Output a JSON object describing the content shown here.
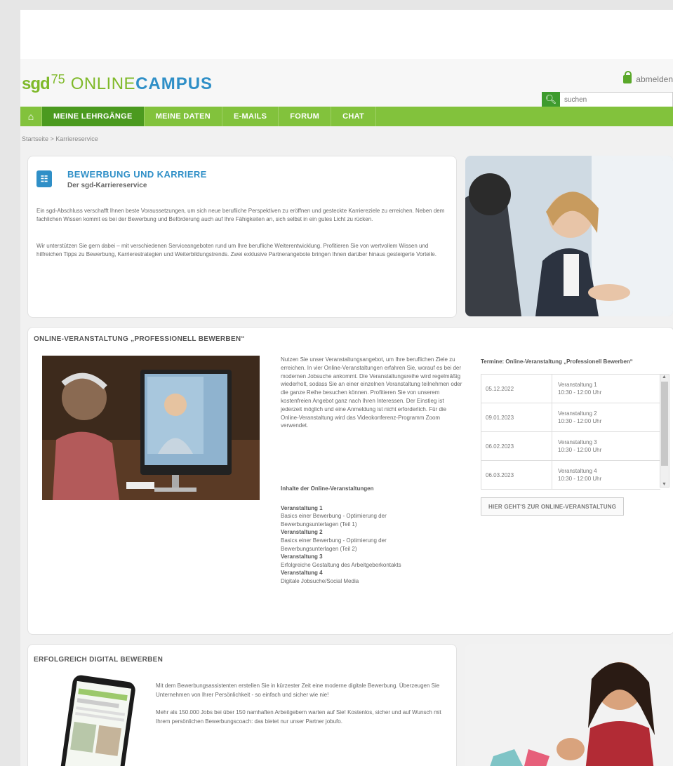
{
  "header": {
    "logo_sgd": "sgd",
    "logo_75": "75",
    "brand_light": "ONLINE",
    "brand_bold": "CAMPUS",
    "logout": "abmelden",
    "search_placeholder": "suchen"
  },
  "nav": {
    "home_icon": "home-icon",
    "items": [
      "MEINE LEHRGÄNGE",
      "MEINE DATEN",
      "E-MAILS",
      "FORUM",
      "CHAT"
    ]
  },
  "breadcrumb": "Startseite > Karriereservice",
  "intro": {
    "title": "BEWERBUNG UND KARRIERE",
    "subtitle": "Der sgd-Karriereservice",
    "p1": "Ein sgd-Abschluss verschafft Ihnen beste Voraussetzungen, um sich neue berufliche Perspektiven zu eröffnen und gesteckte Karriereziele zu erreichen. Neben dem fachlichen Wissen kommt es bei der Bewerbung und Beförderung auch auf Ihre Fähigkeiten an, sich selbst in ein gutes Licht zu rücken.",
    "p2": "Wir unterstützen Sie gern dabei – mit verschiedenen Serviceangeboten rund um Ihre berufliche Weiterentwicklung. Profitieren Sie von wertvollem Wissen und hilfreichen Tipps zu Bewerbung, Karrierestrategien und Weiterbildungstrends. Zwei exklusive Partnerangebote bringen Ihnen darüber hinaus gesteigerte Vorteile."
  },
  "online_event": {
    "title": "ONLINE-VERANSTALTUNG „PROFESSIONELL BEWERBEN“",
    "text": "Nutzen Sie unser Veranstaltungsangebot, um Ihre beruflichen Ziele zu erreichen. In vier Online-Veranstaltungen erfahren Sie, worauf es bei der modernen Jobsuche ankommt. Die Veranstaltungsreihe wird regelmäßig wiederholt, sodass Sie an einer einzelnen Veranstaltung teilnehmen oder die ganze Reihe besuchen können. Profitieren Sie von unserem kostenfreien Angebot ganz nach Ihren Interessen. Der Einstieg ist jederzeit möglich und eine Anmeldung ist nicht erforderlich. Für die Online-Veranstaltung wird das Videokonferenz-Programm Zoom verwendet.",
    "contents_title": "Inhalte der Online-Veranstaltungen",
    "events": [
      {
        "name": "Veranstaltung 1",
        "desc": "Basics einer Bewerbung - Optimierung der Bewerbungsunterlagen (Teil 1)"
      },
      {
        "name": "Veranstaltung 2",
        "desc": "Basics einer Bewerbung - Optimierung der Bewerbungsunterlagen (Teil 2)"
      },
      {
        "name": "Veranstaltung 3",
        "desc": "Erfolgreiche Gestaltung des Arbeitgeberkontakts"
      },
      {
        "name": "Veranstaltung 4",
        "desc": "Digitale Jobsuche/Social Media"
      }
    ],
    "schedule_title": "Termine: Online-Veranstaltung „Professionell Bewerben“",
    "schedule": [
      {
        "date": "05.12.2022",
        "event": "Veranstaltung 1",
        "time": "10:30 - 12:00 Uhr"
      },
      {
        "date": "09.01.2023",
        "event": "Veranstaltung 2",
        "time": "10:30 - 12:00 Uhr"
      },
      {
        "date": "06.02.2023",
        "event": "Veranstaltung 3",
        "time": "10:30 - 12:00 Uhr"
      },
      {
        "date": "06.03.2023",
        "event": "Veranstaltung 4",
        "time": "10:30 - 12:00 Uhr"
      }
    ],
    "button": "HIER GEHT'S ZUR ONLINE-VERANSTALTUNG"
  },
  "digital": {
    "title": "ERFOLGREICH DIGITAL BEWERBEN",
    "p1": "Mit dem Bewerbungsassistenten erstellen Sie in kürzester Zeit eine moderne digitale Bewerbung. Überzeugen Sie Unternehmen von Ihrer Persönlichkeit - so einfach und sicher wie nie!",
    "p2": "Mehr als 150.000 Jobs bei über 150 namhaften Arbeitgebern warten auf Sie! Kostenlos, sicher und auf Wunsch mit Ihrem persönlichen Bewerbungscoach: das bietet nur unser Partner jobufo."
  },
  "colors": {
    "green": "#82c23c",
    "dark_green": "#4b9a1f",
    "blue": "#2f8fc7"
  }
}
